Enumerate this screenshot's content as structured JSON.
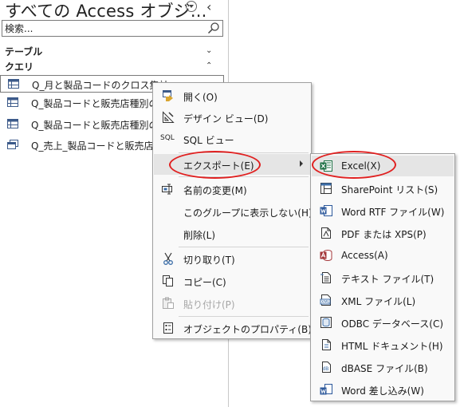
{
  "nav": {
    "title": "すべての Access オブジ...",
    "search_placeholder": "検索...",
    "groups": [
      {
        "label": "テーブル"
      },
      {
        "label": "クエリ"
      }
    ],
    "queries": [
      {
        "label": "Q_月と製品コードのクロス集計",
        "icon": "crosstab-query-icon"
      },
      {
        "label": "Q_製品コードと販売店種別のク",
        "icon": "crosstab-query-icon"
      },
      {
        "label": "Q_製品コードと販売店種別のク",
        "icon": "crosstab-query-icon"
      },
      {
        "label": "Q_売上_製品コードと販売店種",
        "icon": "select-query-icon"
      }
    ]
  },
  "context_menu": {
    "items": [
      {
        "label": "開く(O)",
        "icon": "open-icon"
      },
      {
        "label": "デザイン ビュー(D)",
        "icon": "design-view-icon"
      },
      {
        "label": "SQL ビュー",
        "icon": "sql-icon",
        "icon_text": "SQL"
      },
      {
        "label": "エクスポート(E)",
        "icon": "none",
        "submenu": true
      },
      {
        "label": "名前の変更(M)",
        "icon": "rename-icon"
      },
      {
        "label": "このグループに表示しない(H)",
        "icon": "none"
      },
      {
        "label": "削除(L)",
        "icon": "none"
      },
      {
        "label": "切り取り(T)",
        "icon": "scissors-icon"
      },
      {
        "label": "コピー(C)",
        "icon": "copy-icon"
      },
      {
        "label": "貼り付け(P)",
        "icon": "paste-icon",
        "disabled": true
      },
      {
        "label": "オブジェクトのプロパティ(B)",
        "icon": "properties-icon"
      }
    ]
  },
  "export_submenu": {
    "items": [
      {
        "label": "Excel(X)",
        "icon": "excel-icon"
      },
      {
        "label": "SharePoint リスト(S)",
        "icon": "sharepoint-list-icon"
      },
      {
        "label": "Word RTF ファイル(W)",
        "icon": "word-rtf-icon"
      },
      {
        "label": "PDF または XPS(P)",
        "icon": "pdf-icon"
      },
      {
        "label": "Access(A)",
        "icon": "access-icon"
      },
      {
        "label": "テキスト ファイル(T)",
        "icon": "text-file-icon"
      },
      {
        "label": "XML ファイル(L)",
        "icon": "xml-icon"
      },
      {
        "label": "ODBC データベース(C)",
        "icon": "odbc-icon"
      },
      {
        "label": "HTML ドキュメント(H)",
        "icon": "html-icon"
      },
      {
        "label": "dBASE ファイル(B)",
        "icon": "dbase-icon"
      },
      {
        "label": "Word 差し込み(W)",
        "icon": "word-merge-icon"
      }
    ]
  },
  "colors": {
    "annotation_ring": "#e02020",
    "excel_green": "#1e7145",
    "word_blue": "#2b579a",
    "access_red": "#a4373a"
  }
}
